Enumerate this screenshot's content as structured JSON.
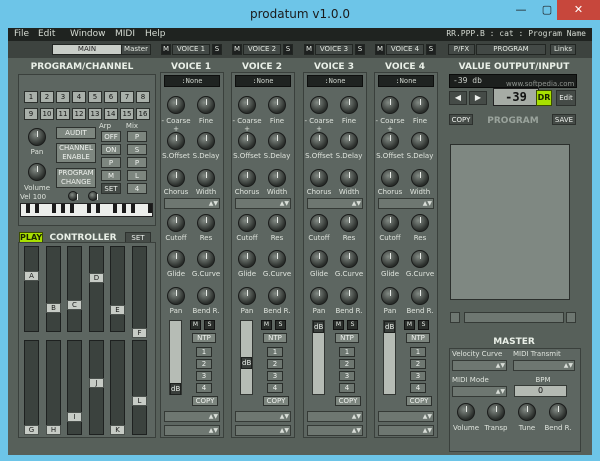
{
  "window": {
    "title": "prodatum v1.0.0",
    "min": "—",
    "max": "▢",
    "close": "✕"
  },
  "menu": {
    "items": [
      "File",
      "Edit",
      "Window",
      "MIDI",
      "Help"
    ],
    "path": "RR.PPP.B : cat : Program Name"
  },
  "tabs": {
    "main": "MAIN",
    "master": "Master",
    "voices": [
      "VOICE 1",
      "VOICE 2",
      "VOICE 3",
      "VOICE 4"
    ],
    "voice_markers": [
      "M",
      "S"
    ],
    "pfx": "P/FX",
    "program": "PROGRAM",
    "links": "Links"
  },
  "program_channel": {
    "heading": "PROGRAM/CHANNEL",
    "channels": [
      "1",
      "2",
      "3",
      "4",
      "5",
      "6",
      "7",
      "8",
      "9",
      "10",
      "11",
      "12",
      "13",
      "14",
      "15",
      "16"
    ],
    "audit": "AUDIT",
    "channel_enable": "CHANNEL ENABLE",
    "program_change": "PROGRAM CHANGE",
    "pan": "Pan",
    "volume": "Volume",
    "vel": "Vel 100",
    "arp_label": "Arp",
    "mix_label": "Mix",
    "arp": [
      "OFF",
      "ON",
      "P",
      "M",
      "SET"
    ],
    "mix": [
      "P",
      "S",
      "P",
      "L",
      "4"
    ]
  },
  "controller": {
    "play": "PLAY",
    "heading": "CONTROLLER",
    "set": "SET",
    "upper": [
      "A",
      "B",
      "C",
      "D",
      "E",
      "F"
    ],
    "lower": [
      "G",
      "H",
      "I",
      "J",
      "K",
      "L"
    ]
  },
  "voice": {
    "titles": [
      "VOICE 1",
      "VOICE 2",
      "VOICE 3",
      "VOICE 4"
    ],
    "instrument": ":None",
    "coarse": "- Coarse +",
    "fine": "Fine",
    "s_offset": "S.Offset",
    "s_delay": "S.Delay",
    "chorus": "Chorus",
    "width": "Width",
    "cutoff": "Cutoff",
    "res": "Res",
    "glide": "Glide",
    "g_curve": "G.Curve",
    "pan": "Pan",
    "bend": "Bend R.",
    "m": "M",
    "s": "S",
    "ntp": "NTP",
    "db": "dB",
    "layers": [
      "1",
      "2",
      "3",
      "4"
    ],
    "copy": "COPY"
  },
  "value_output": {
    "heading": "VALUE OUTPUT/INPUT",
    "readout": "-39 db",
    "value": "-39",
    "dr": "DR",
    "edit": "Edit",
    "left": "◀",
    "right": "▶"
  },
  "program_panel": {
    "copy": "COPY",
    "heading": "PROGRAM",
    "save": "SAVE"
  },
  "master": {
    "heading": "MASTER",
    "velocity_curve": "Velocity Curve",
    "midi_transmit": "MIDI Transmit",
    "midi_mode": "MIDI Mode",
    "bpm": "BPM",
    "bpm_value": "0",
    "knobs": [
      "Volume",
      "Transp",
      "Tune",
      "Bend R."
    ]
  },
  "watermark": "www.softpedia.com"
}
